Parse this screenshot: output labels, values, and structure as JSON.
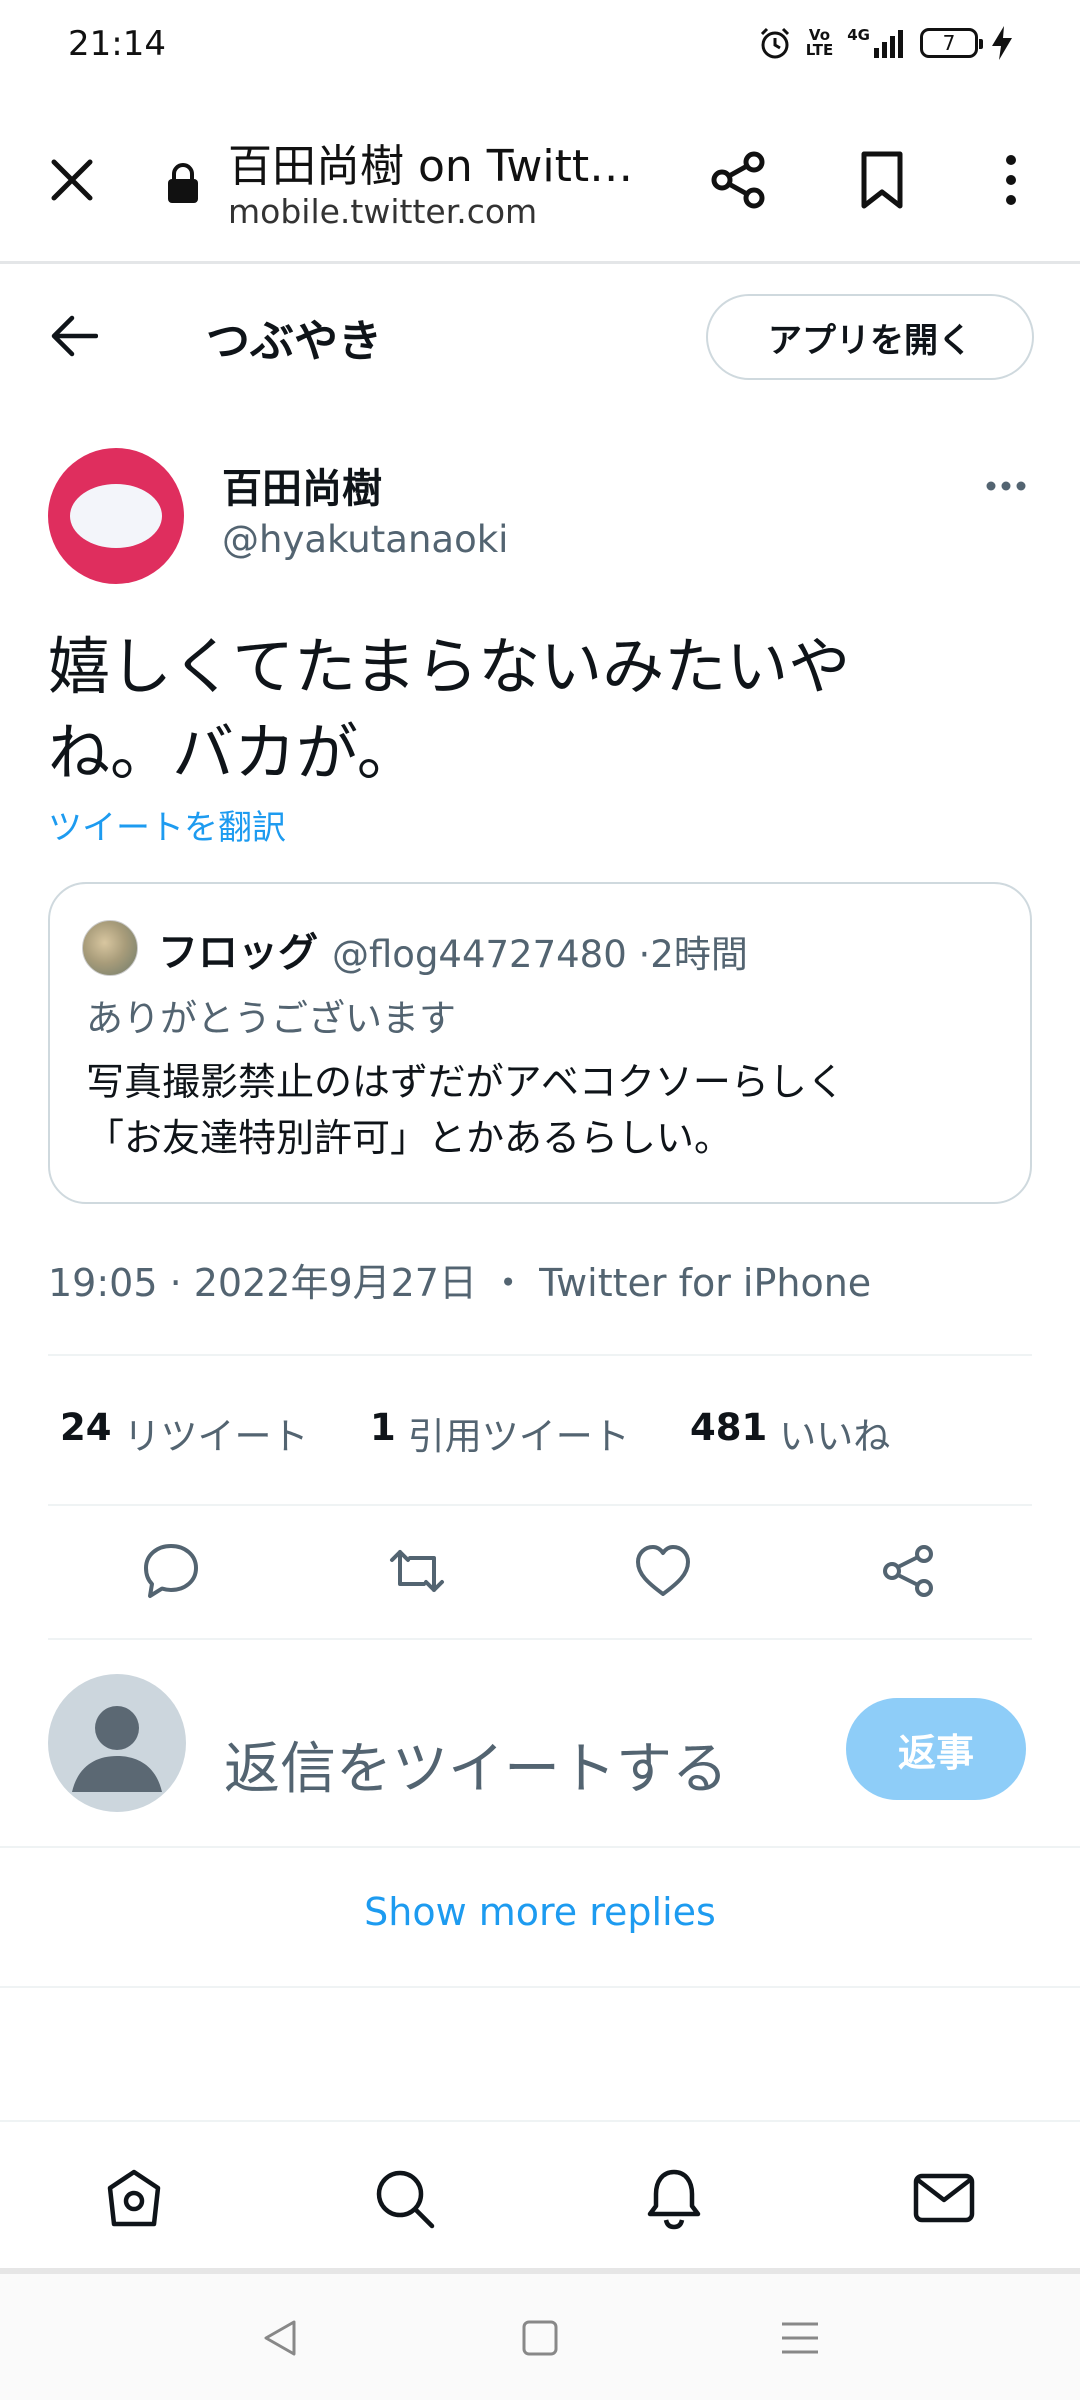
{
  "status_bar": {
    "time": "21:14",
    "volte_top": "Vo",
    "volte_bottom": "LTE",
    "network": "4G",
    "battery": "7",
    "icons": [
      "alarm-icon",
      "signal-icon",
      "battery-icon",
      "charging-icon"
    ]
  },
  "browser": {
    "title": "百田尚樹 on Twitt…",
    "url": "mobile.twitter.com",
    "icons": [
      "close-icon",
      "lock-icon",
      "share-icon",
      "bookmark-icon",
      "overflow-menu-icon"
    ]
  },
  "header": {
    "title": "つぶやき",
    "open_app": "アプリを開く"
  },
  "tweet": {
    "author_name": "百田尚樹",
    "author_handle": "@hyakutanaoki",
    "text_line1": "嬉しくてたまらないみたいや",
    "text_line2": "ね。バカが。",
    "translate": "ツイートを翻訳",
    "quote": {
      "name": "フロッグ",
      "handle_time": "@flog44727480 ·2時間",
      "reply_line": "ありがとうございます",
      "text_line1": "写真撮影禁止のはずだがアベコクソーらしく",
      "text_line2": "「お友達特別許可」とかあるらしい。"
    },
    "meta": "19:05 · 2022年9月27日  ・ Twitter for iPhone",
    "stats": {
      "retweets_count": "24",
      "retweets_label": "リツイート",
      "quotes_count": "1",
      "quotes_label": "引用ツイート",
      "likes_count": "481",
      "likes_label": "いいね"
    }
  },
  "reply": {
    "placeholder": "返信をツイートする",
    "button": "返事"
  },
  "show_more": "Show more replies",
  "colors": {
    "accent": "#1d9bf0",
    "reply_button": "#8ecdf8",
    "avatar": "#df2e5e",
    "muted_text": "#536471"
  }
}
